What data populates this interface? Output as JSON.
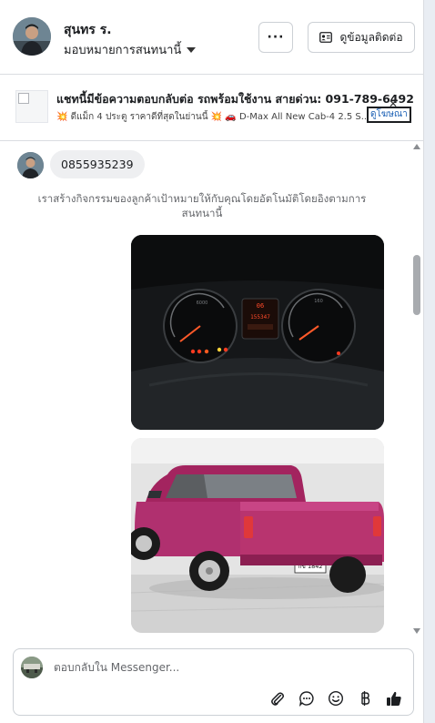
{
  "header": {
    "name": "สุนทร ร.",
    "assign_label": "มอบหมายการสนทนานี้",
    "more_label": "···",
    "contact_button_label": "ดูข้อมูลติดต่อ"
  },
  "ad": {
    "title": "แชทนี้มีข้อความตอบกลับต่อ รถพร้อมใช้งาน สายด่วน: 091-789-6492",
    "subtitle_prefix": "💥",
    "subtitle_main": " ดีแม็ก 4 ประตู ราคาดีที่สุดในย่านนี้ ",
    "subtitle_suffix": "💥",
    "subtitle_car": " 🚗 D-Max All New Cab-4 2.5 S...",
    "link_label": "ดูโฆษณา",
    "close_label": "✕"
  },
  "chat": {
    "phone_message": "0855935239",
    "system_message": "เราสร้างกิจกรรมของลูกค้าเป้าหมายให้กับคุณโดยอัตโนมัติโดยอิงตามการสนทนานี้",
    "photo1_display": {
      "left_gauge": "6000",
      "center_display": "06",
      "center_readout": "155347",
      "right_gauge": "160"
    },
    "photo2_plate": "กข 1842"
  },
  "composer": {
    "placeholder": "ตอบกลับใน Messenger..."
  },
  "colors": {
    "border": "#dadde1",
    "bubble": "#eeeff1",
    "car": "#b0306f",
    "link": "#1a5fb4"
  },
  "icons": [
    "more-icon",
    "contact-card-icon",
    "chevron-down-icon",
    "attachment-icon",
    "saved-reply-icon",
    "emoji-icon",
    "baht-icon",
    "like-icon"
  ]
}
